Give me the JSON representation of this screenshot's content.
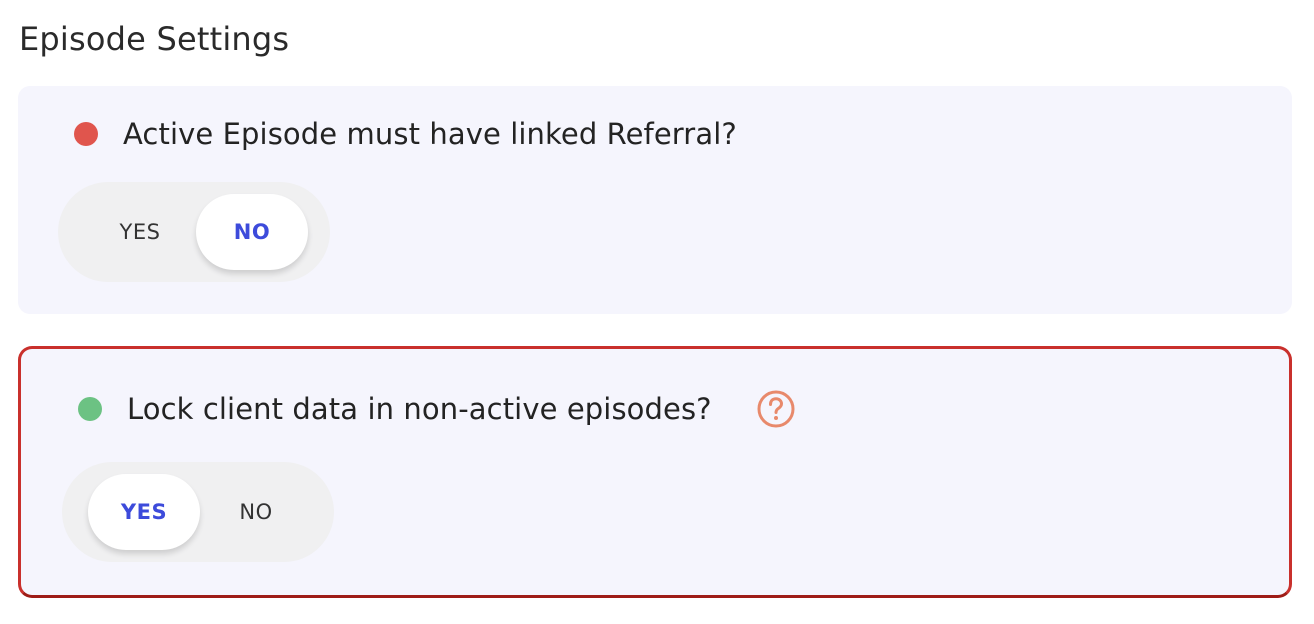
{
  "section": {
    "title": "Episode Settings"
  },
  "settings": [
    {
      "question": "Active Episode must have linked Referral?",
      "status_color": "#e0554d",
      "options": [
        "YES",
        "NO"
      ],
      "selected": "NO",
      "has_help": false,
      "highlighted": false
    },
    {
      "question": "Lock client data in non-active episodes?",
      "status_color": "#6cc283",
      "options": [
        "YES",
        "NO"
      ],
      "selected": "YES",
      "has_help": true,
      "help_icon": "question-circle-icon",
      "help_icon_color": "#e8896b",
      "highlighted": true,
      "highlight_color": "#c9302c"
    }
  ],
  "colors": {
    "card_bg": "#f5f5fd",
    "toggle_bg": "#f0f0f1",
    "active_text": "#3d4bdb"
  }
}
